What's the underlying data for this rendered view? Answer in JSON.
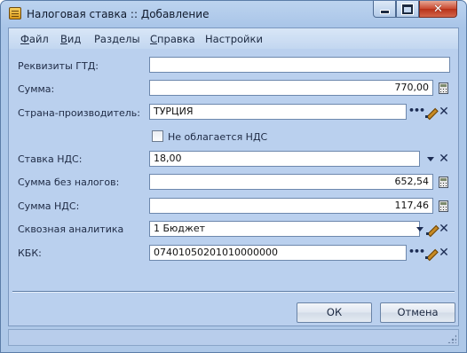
{
  "window": {
    "title": "Налоговая ставка :: Добавление"
  },
  "menu": {
    "items": [
      {
        "label": "Файл",
        "underline_index": 0
      },
      {
        "label": "Вид",
        "underline_index": 0
      },
      {
        "label": "Разделы",
        "underline_index": -1
      },
      {
        "label": "Справка",
        "underline_index": 0
      },
      {
        "label": "Настройки",
        "underline_index": -1
      }
    ]
  },
  "form": {
    "gtd_label": "Реквизиты ГТД:",
    "gtd_value": "",
    "sum_label": "Сумма:",
    "sum_value": "770,00",
    "country_label": "Страна-производитель:",
    "country_value": "ТУРЦИЯ",
    "vat_exempt_label": "Не облагается НДС",
    "vat_exempt_checked": false,
    "vat_rate_label": "Ставка НДС:",
    "vat_rate_value": "18,00",
    "sum_without_tax_label": "Сумма без налогов:",
    "sum_without_tax_value": "652,54",
    "vat_sum_label": "Сумма НДС:",
    "vat_sum_value": "117,46",
    "analytics_label": "Сквозная аналитика",
    "analytics_value": "1 Бюджет",
    "kbk_label": "КБК:",
    "kbk_value": "07401050201010000000"
  },
  "buttons": {
    "ok": "ОК",
    "cancel": "Отмена"
  },
  "icons": {
    "app": "form-icon",
    "calculator": "calculator-icon",
    "lookup": "ellipsis-icon",
    "edit": "pencil-icon",
    "clear": "clear-x-icon",
    "dropdown": "chevron-down-icon"
  },
  "colors": {
    "window_frame": "#a9c5e8",
    "client_bg": "#bad0ee",
    "close_button": "#c9482f"
  }
}
